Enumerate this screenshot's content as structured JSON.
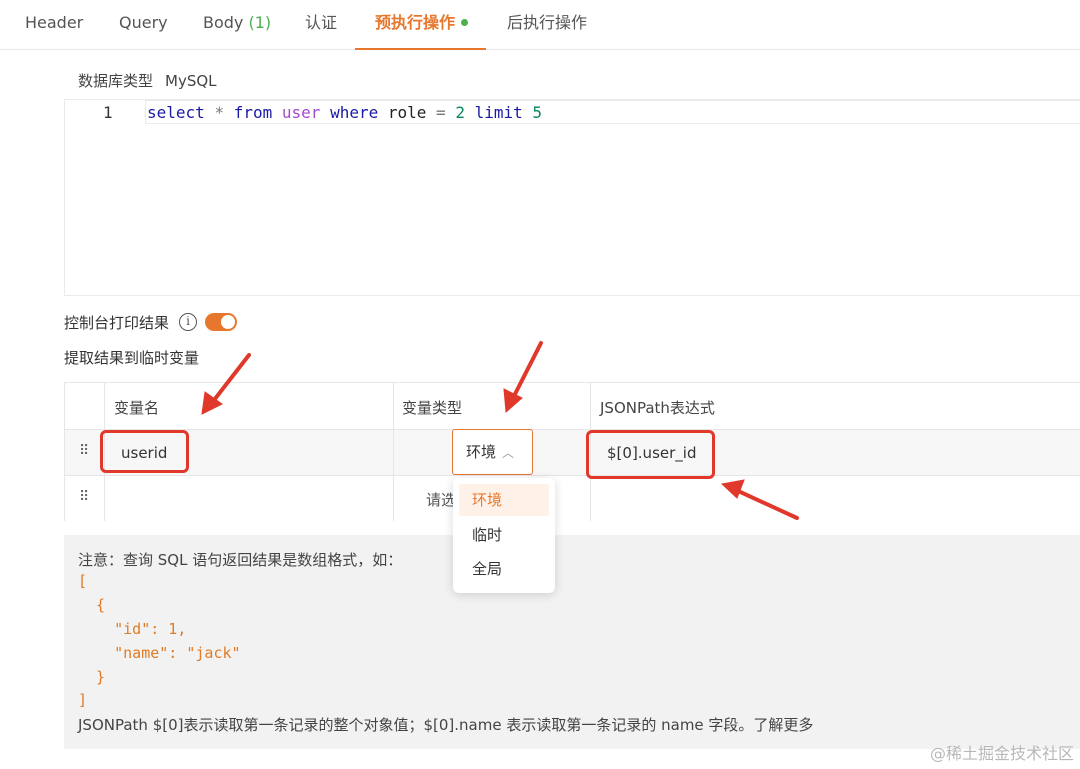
{
  "tabs": [
    {
      "label": "Header"
    },
    {
      "label": "Query"
    },
    {
      "label": "Body",
      "count": "(1)"
    },
    {
      "label": "认证"
    },
    {
      "label": "预执行操作"
    },
    {
      "label": "后执行操作"
    }
  ],
  "db": {
    "label": "数据库类型",
    "value": "MySQL"
  },
  "editor": {
    "line_number": "1",
    "tokens": [
      "select",
      "*",
      "from",
      "user",
      "where",
      "role",
      "=",
      "2",
      "limit",
      "5"
    ]
  },
  "console": {
    "label": "控制台打印结果",
    "info_icon": "i",
    "toggle_on": true
  },
  "extract_title": "提取结果到临时变量",
  "table": {
    "headers": [
      "变量名",
      "变量类型",
      "JSONPath表达式"
    ],
    "rows": [
      {
        "name": "userid",
        "type": "环境",
        "path": "$[0].user_id"
      },
      {
        "name": "",
        "type_placeholder": "请选",
        "path": ""
      }
    ]
  },
  "dropdown": {
    "options": [
      "环境",
      "临时",
      "全局"
    ],
    "selected": "环境"
  },
  "note": {
    "intro": "注意：查询 SQL 语句返回结果是数组格式，如：",
    "json_lines": [
      "[",
      "  {",
      "    \"id\": 1,",
      "    \"name\": \"jack\"",
      "  }",
      "]"
    ],
    "footer": "JSONPath $[0]表示读取第一条记录的整个对象值；$[0].name 表示读取第一条记录的 name 字段。了解更多"
  },
  "watermark": "@稀土掘金技术社区",
  "colors": {
    "accent": "#e8772e",
    "annotation": "#e0382b",
    "success": "#4caf50"
  }
}
